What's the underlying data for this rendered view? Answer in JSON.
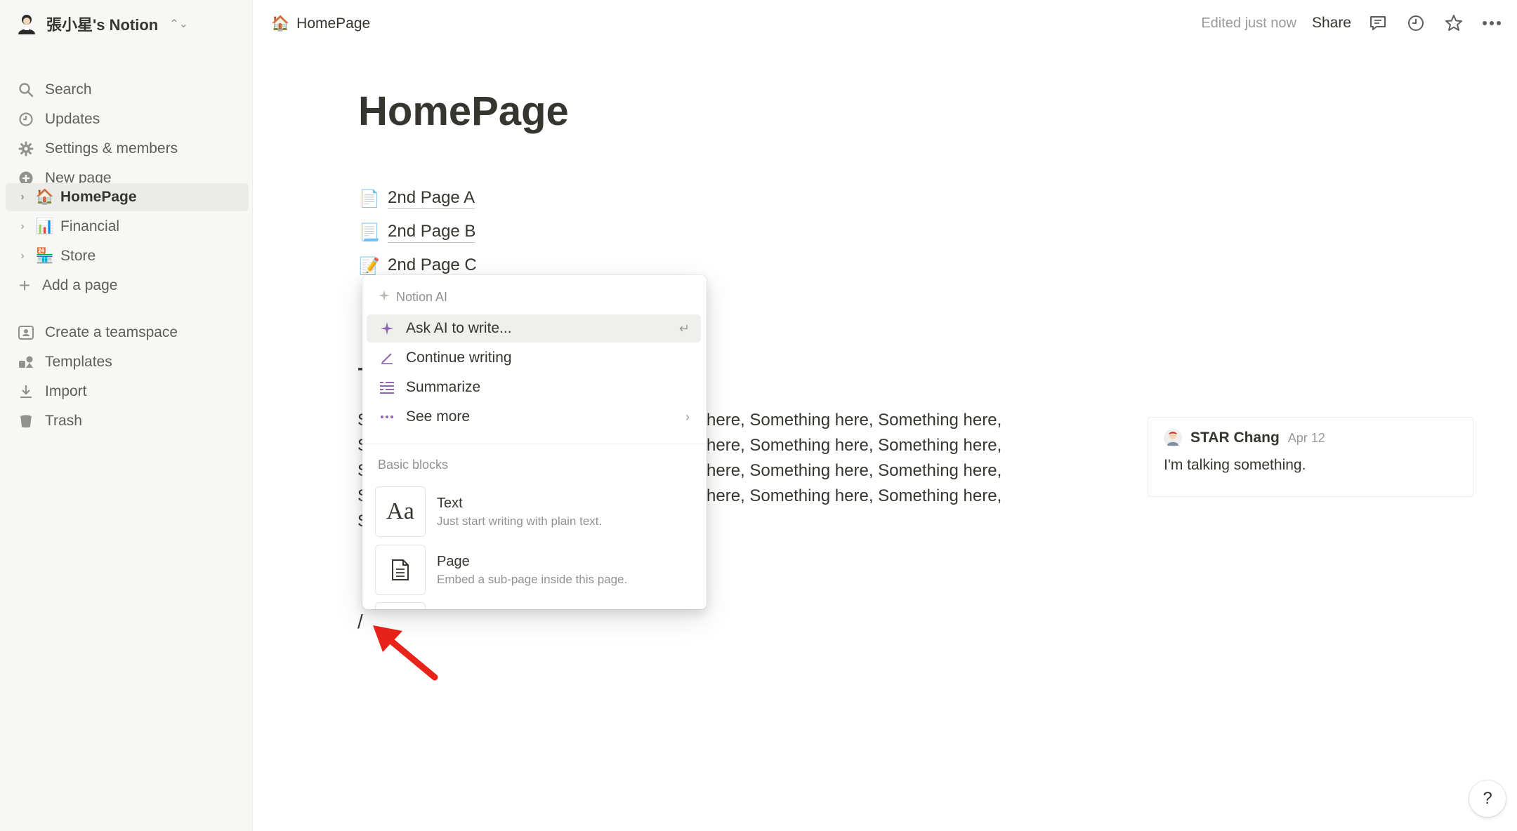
{
  "workspace": {
    "avatar_icon": "person-avatar-icon",
    "name": "張小星's Notion"
  },
  "sidebar": {
    "nav": [
      {
        "label": "Search",
        "icon": "search-icon"
      },
      {
        "label": "Updates",
        "icon": "clock-icon"
      },
      {
        "label": "Settings & members",
        "icon": "gear-icon"
      },
      {
        "label": "New page",
        "icon": "plus-circle-icon"
      }
    ],
    "pages": [
      {
        "emoji": "🏠",
        "label": "HomePage",
        "active": true
      },
      {
        "emoji": "📊",
        "label": "Financial",
        "active": false
      },
      {
        "emoji": "🏪",
        "label": "Store",
        "active": false
      }
    ],
    "add_page": "Add a page",
    "bottom": [
      {
        "label": "Create a teamspace",
        "icon": "teamspace-icon"
      },
      {
        "label": "Templates",
        "icon": "templates-icon"
      },
      {
        "label": "Import",
        "icon": "import-icon"
      },
      {
        "label": "Trash",
        "icon": "trash-icon"
      }
    ]
  },
  "topbar": {
    "breadcrumb_emoji": "🏠",
    "breadcrumb": "HomePage",
    "edited": "Edited just now",
    "share": "Share"
  },
  "page": {
    "title": "HomePage",
    "subpages": [
      {
        "emoji": "📄",
        "label": "2nd Page A"
      },
      {
        "emoji": "📃",
        "label": "2nd Page B"
      },
      {
        "emoji": "📝",
        "label": "2nd Page C"
      }
    ],
    "body_lines": [
      "S",
      "S",
      "S",
      "S",
      "S"
    ],
    "body_right_lines": [
      "here, Something here, Something here,",
      "here, Something here, Something here,",
      "here, Something here, Something here,",
      "here, Something here, Something here,"
    ],
    "slash_input": "/"
  },
  "comment": {
    "author": "STAR Chang",
    "date": "Apr 12",
    "text": "I'm talking something."
  },
  "slash_menu": {
    "section_ai": "Notion AI",
    "ai_items": [
      {
        "label": "Ask AI to write...",
        "icon": "sparkle-icon",
        "highlighted": true,
        "right": "↵"
      },
      {
        "label": "Continue writing",
        "icon": "pen-icon",
        "highlighted": false,
        "right": ""
      },
      {
        "label": "Summarize",
        "icon": "list-icon",
        "highlighted": false,
        "right": ""
      },
      {
        "label": "See more",
        "icon": "ellipsis-icon",
        "highlighted": false,
        "right": "›"
      }
    ],
    "section_basic": "Basic blocks",
    "blocks": [
      {
        "title": "Text",
        "desc": "Just start writing with plain text.",
        "icon": "text-aa-icon"
      },
      {
        "title": "Page",
        "desc": "Embed a sub-page inside this page.",
        "icon": "page-doc-icon"
      }
    ]
  },
  "help": "?"
}
